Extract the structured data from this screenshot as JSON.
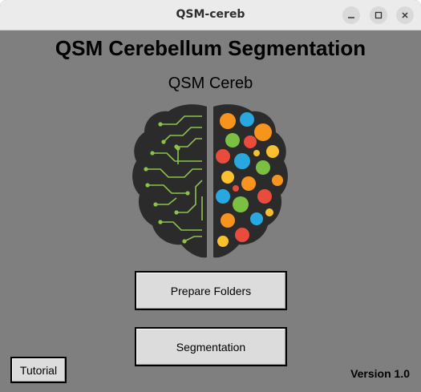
{
  "window": {
    "title": "QSM-cereb",
    "controls": [
      "minimize-icon",
      "maximize-icon",
      "close-icon"
    ]
  },
  "main": {
    "heading": "QSM Cerebellum Segmentation",
    "subheading": "QSM Cereb",
    "logo": "brain-icon",
    "prepare_button": "Prepare Folders",
    "segmentation_button": "Segmentation",
    "tutorial_button": "Tutorial",
    "version": "Version 1.0"
  },
  "colors": {
    "background": "#7f7f7f",
    "titlebar": "#ebebeb",
    "button": "#dcdcdc",
    "circuit_green": "#8bc34a",
    "brain_dark": "#2b2b2b"
  }
}
